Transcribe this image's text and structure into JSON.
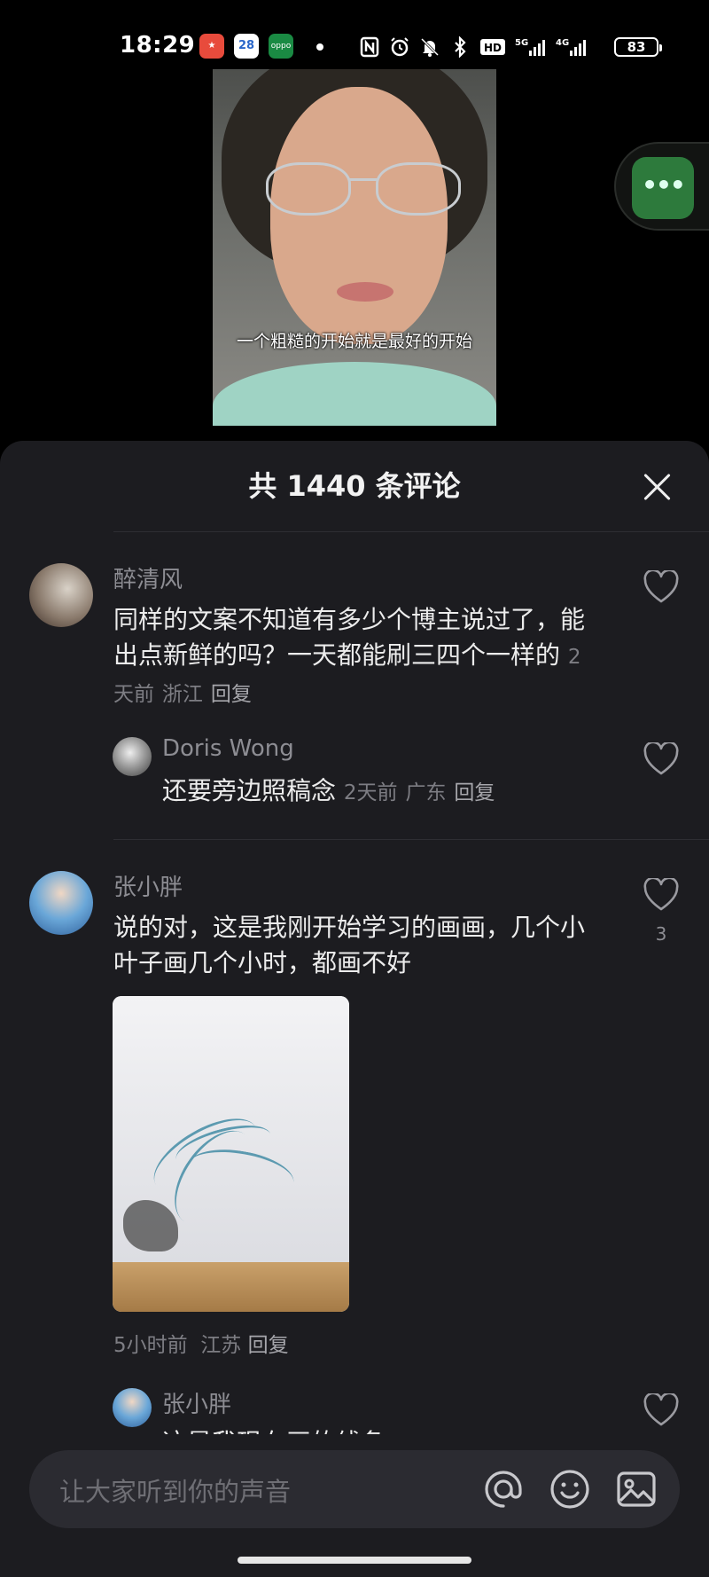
{
  "status_bar": {
    "time": "18:29",
    "app_icons": [
      "sale-app-icon",
      "calendar-app-icon",
      "oppo-app-icon"
    ],
    "calendar_day": "28",
    "oppo_label": "oppo",
    "network_5g": "5G",
    "network_4g": "4G",
    "hd_label": "HD",
    "battery": "83"
  },
  "video": {
    "caption": "一个粗糙的开始就是最好的开始"
  },
  "side_button": {
    "label": "•••"
  },
  "comments_panel": {
    "title": "共 1440 条评论",
    "comments": [
      {
        "user": "醉清风",
        "text": "同样的文案不知道有多少个博主说过了，能出点新鲜的吗？一天都能刷三四个一样的",
        "time": "2天前",
        "location": "浙江",
        "reply_label": "回复",
        "replies": [
          {
            "user": "Doris Wong",
            "text": "还要旁边照稿念",
            "time": "2天前",
            "location": "广东",
            "reply_label": "回复"
          }
        ]
      },
      {
        "user": "张小胖",
        "text": "说的对，这是我刚开始学习的画画，几个小叶子画几个小时，都画不好",
        "likes": "3",
        "time": "5小时前",
        "location": "江苏",
        "reply_label": "回复",
        "replies": [
          {
            "user": "张小胖",
            "text": "这是我现在画的线条"
          }
        ]
      }
    ]
  },
  "input_bar": {
    "placeholder": "让大家听到你的声音"
  },
  "colors": {
    "sheet_bg": "#1c1c20",
    "accent_green": "#2d7a3c",
    "muted_text": "#8d8d93"
  }
}
